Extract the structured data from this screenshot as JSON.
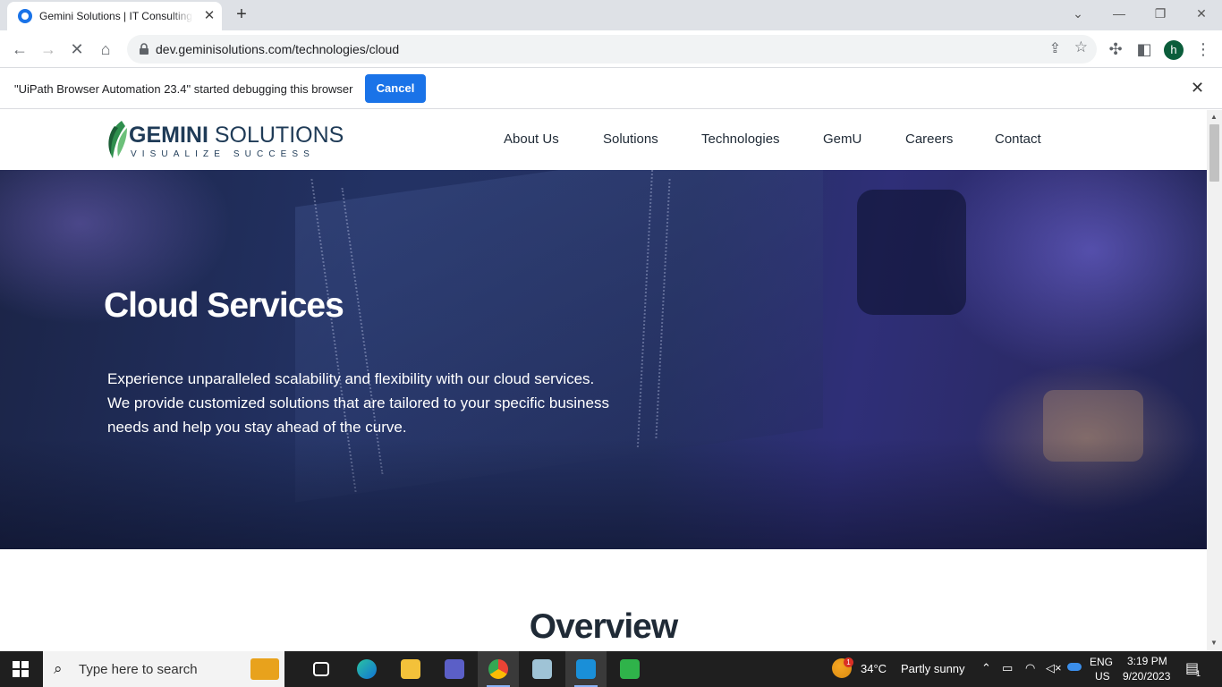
{
  "browser": {
    "tab_title": "Gemini Solutions | IT Consulting",
    "tab_close": "✕",
    "new_tab": "+",
    "url": "dev.geminisolutions.com/technologies/cloud",
    "profile_initial": "h"
  },
  "infobar": {
    "message": "\"UiPath Browser Automation 23.4\" started debugging this browser",
    "cancel_label": "Cancel",
    "close": "✕"
  },
  "site": {
    "logo": {
      "brand_bold": "GEMINI",
      "brand_light": " SOLUTIONS",
      "tagline": "VISUALIZE SUCCESS"
    },
    "nav": [
      "About Us",
      "Solutions",
      "Technologies",
      "GemU",
      "Careers",
      "Contact"
    ],
    "hero": {
      "title": "Cloud Services",
      "description": "Experience unparalleled scalability and flexibility with our cloud services. We provide customized solutions that are tailored to your specific business needs and help you stay ahead of the curve."
    },
    "section_title": "Overview"
  },
  "taskbar": {
    "search_placeholder": "Type here to search",
    "weather_temp": "34°C",
    "weather_text": "Partly sunny",
    "weather_badge": "1",
    "lang": "ENG",
    "region": "US",
    "time": "3:19 PM",
    "date": "9/20/2023",
    "notif_count": "1"
  },
  "colors": {
    "accent": "#1a73e8",
    "brand_navy": "#1f3b57",
    "brand_green": "#3aa35c"
  }
}
